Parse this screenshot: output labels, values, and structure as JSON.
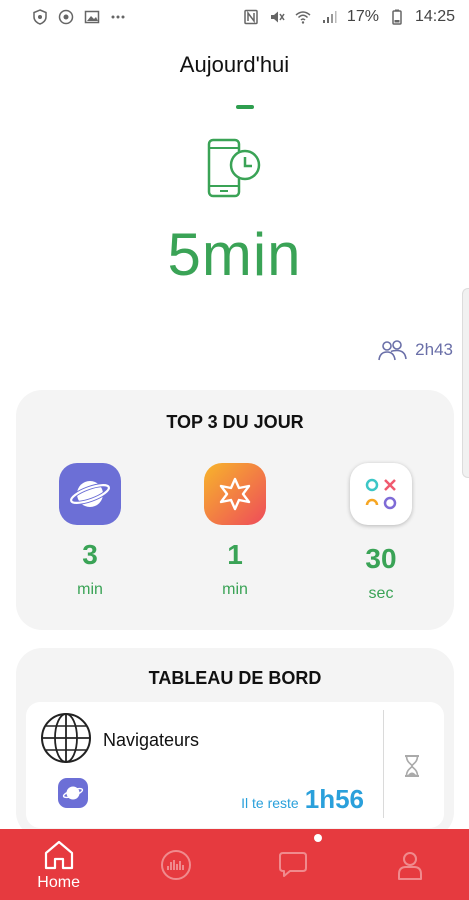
{
  "status_bar": {
    "battery_pct": "17%",
    "time": "14:25",
    "left_icons": [
      "shield-icon",
      "vpn-icon",
      "image-icon",
      "more-dots-icon"
    ],
    "right_icons": [
      "nfc-icon",
      "mute-icon",
      "wifi-icon",
      "signal-icon",
      "battery-icon"
    ]
  },
  "header": {
    "title": "Aujourd'hui"
  },
  "summary": {
    "total_time": "5min",
    "family_time": "2h43"
  },
  "top3": {
    "title": "TOP 3 DU JOUR",
    "apps": [
      {
        "icon": "samsung-internet-icon",
        "value": "3",
        "unit": "min",
        "color": "#6c6fd6"
      },
      {
        "icon": "galaxy-store-icon",
        "value": "1",
        "unit": "min",
        "color": "#f06a2f"
      },
      {
        "icon": "game-launcher-icon",
        "value": "30",
        "unit": "sec",
        "color": "#ffffff"
      }
    ]
  },
  "dashboard": {
    "title": "TABLEAU DE BORD",
    "category": "Navigateurs",
    "remaining_label": "Il te reste",
    "remaining_value": "1h56"
  },
  "bottom_nav": {
    "items": [
      {
        "icon": "home-icon",
        "label": "Home",
        "active": true
      },
      {
        "icon": "stats-icon",
        "label": "",
        "active": false
      },
      {
        "icon": "chat-icon",
        "label": "",
        "active": false
      },
      {
        "icon": "profile-icon",
        "label": "",
        "active": false
      }
    ],
    "background": "#e63a3f"
  },
  "colors": {
    "accent_green": "#3aa356",
    "accent_blue": "#2aa0db",
    "family_purple": "#6a6fa8"
  }
}
